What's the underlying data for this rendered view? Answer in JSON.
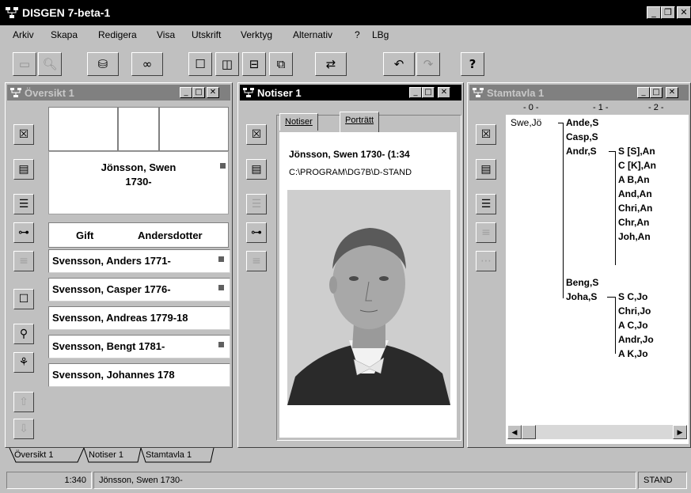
{
  "app": {
    "title": "DISGEN 7-beta-1"
  },
  "menu": [
    "Arkiv",
    "Skapa",
    "Redigera",
    "Visa",
    "Utskrift",
    "Verktyg",
    "Alternativ",
    "?",
    "LBg"
  ],
  "toolbar": {
    "icons": [
      "print-icon",
      "print-preview-icon",
      "database-icon",
      "binoculars-icon",
      "window-single-icon",
      "window-split-vertical-icon",
      "window-split-horizontal-icon",
      "window-cascade-icon",
      "switch-icon",
      "undo-icon",
      "redo-icon",
      "help-icon"
    ],
    "help_label": "?"
  },
  "overview": {
    "title": "Översikt 1",
    "person": "Jönsson, Swen",
    "person_year": "1730-",
    "marriage_label": "Gift",
    "spouse": "Andersdotter",
    "children": [
      "Svensson, Anders 1771-",
      "Svensson, Casper 1776-",
      "Svensson, Andreas 1779-18",
      "Svensson, Bengt 1781-",
      "Svensson, Johannes 178"
    ]
  },
  "notes": {
    "title": "Notiser 1",
    "tabs": [
      "Notiser",
      "Porträtt"
    ],
    "heading": "Jönsson, Swen 1730- (1:34",
    "path": "C:\\PROGRAM\\DG7B\\D-STAND"
  },
  "pedigree": {
    "title": "Stamtavla 1",
    "columns": [
      "- 0 -",
      "- 1 -",
      "- 2 -"
    ],
    "root": "Swe,Jö",
    "gen1": [
      "Ande,S",
      "Casp,S",
      "Andr,S",
      "Beng,S",
      "Joha,S"
    ],
    "gen2_a": [
      "S [S],An",
      "C [K],An",
      "A B,An",
      "And,An",
      "Chri,An",
      "Chr,An",
      "Joh,An"
    ],
    "gen2_b": [
      "S C,Jo",
      "Chri,Jo",
      "A C,Jo",
      "Andr,Jo",
      "A K,Jo"
    ]
  },
  "doc_tabs": [
    "Översikt 1",
    "Notiser 1",
    "Stamtavla 1"
  ],
  "status": {
    "id": "1:340",
    "name": "Jönsson, Swen 1730-",
    "db": "STAND"
  },
  "colors": {
    "face": "#c0c0c0",
    "titlebar_active": "#000000",
    "titlebar_inactive": "#808080"
  }
}
